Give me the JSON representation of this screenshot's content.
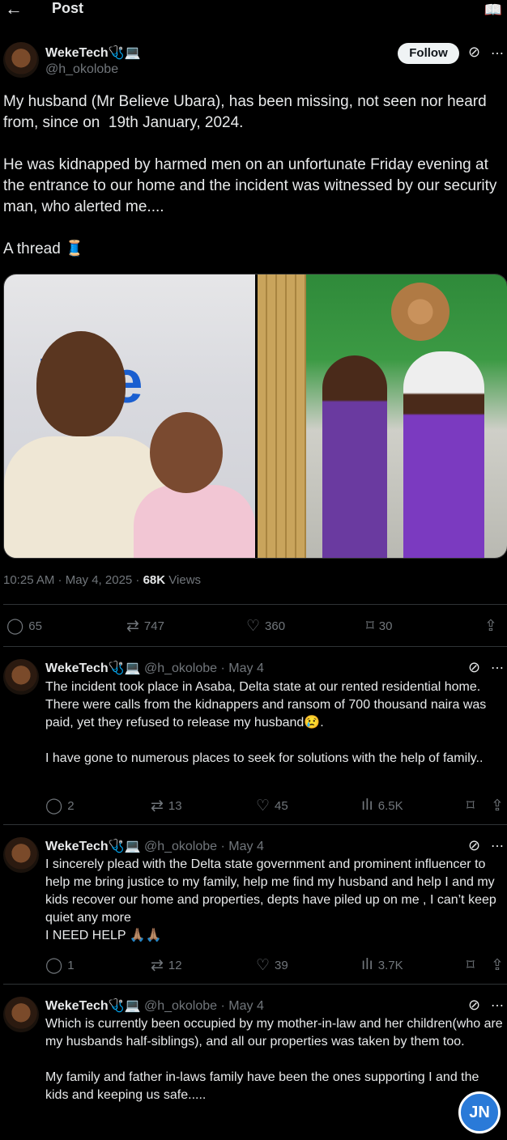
{
  "header": {
    "title": "Post"
  },
  "post": {
    "author": "WekeTech",
    "author_emoji": "🩺💻",
    "handle": "@h_okolobe",
    "follow_label": "Follow",
    "text": "My husband (Mr Believe Ubara), has been missing, not seen nor heard from, since on  19th January, 2024.\n\nHe was kidnapped by harmed men on an unfortunate Friday evening at the entrance to our home and the incident was witnessed by our security man, who alerted me....\n\nA thread 🧵",
    "photo_left_logo": "inte",
    "time": "10:25 AM · May 4, 2025 · ",
    "views_count": "68K",
    "views_label": " Views",
    "stats": {
      "replies": "65",
      "reposts": "747",
      "likes": "360",
      "bookmarks": "30"
    }
  },
  "replies": [
    {
      "author": "WekeTech",
      "author_emoji": "🩺💻",
      "handle_date": "@h_okolobe · May 4",
      "text": "The incident took place in Asaba, Delta state at our rented residential home. There were calls from the kidnappers and ransom of 700 thousand naira was paid, yet they refused to release my husband😢.\n\nI have gone to numerous places to seek for solutions with the help of family..",
      "replies": "2",
      "reposts": "13",
      "likes": "45",
      "views": "6.5K"
    },
    {
      "author": "WekeTech",
      "author_emoji": "🩺💻",
      "handle_date": "@h_okolobe · May 4",
      "text": "I sincerely plead with the Delta state government and prominent influencer to help me bring justice to my family, help me find my husband and help I and my kids recover our home and properties, depts have piled up on me , I can’t keep quiet any more\nI NEED HELP 🙏🏽🙏🏽",
      "replies": "1",
      "reposts": "12",
      "likes": "39",
      "views": "3.7K"
    },
    {
      "author": "WekeTech",
      "author_emoji": "🩺💻",
      "handle_date": "@h_okolobe · May 4",
      "text": "Which is currently been occupied by my mother-in-law and her children(who are my husbands half-siblings), and all our properties was taken by them too.\n\nMy family and father in-laws family have been the ones supporting I and the kids and keeping us safe.....",
      "replies": "",
      "reposts": "",
      "likes": "",
      "views": ""
    }
  ],
  "watermark": "JN",
  "colors": {
    "background": "#000000",
    "text": "#e7e9ea",
    "muted": "#71767b",
    "divider": "#2f3336"
  },
  "icons": [
    "back-arrow-icon",
    "reader-icon",
    "grok-icon",
    "more-icon",
    "reply-icon",
    "repost-icon",
    "like-icon",
    "bookmark-icon",
    "share-icon",
    "views-icon"
  ]
}
